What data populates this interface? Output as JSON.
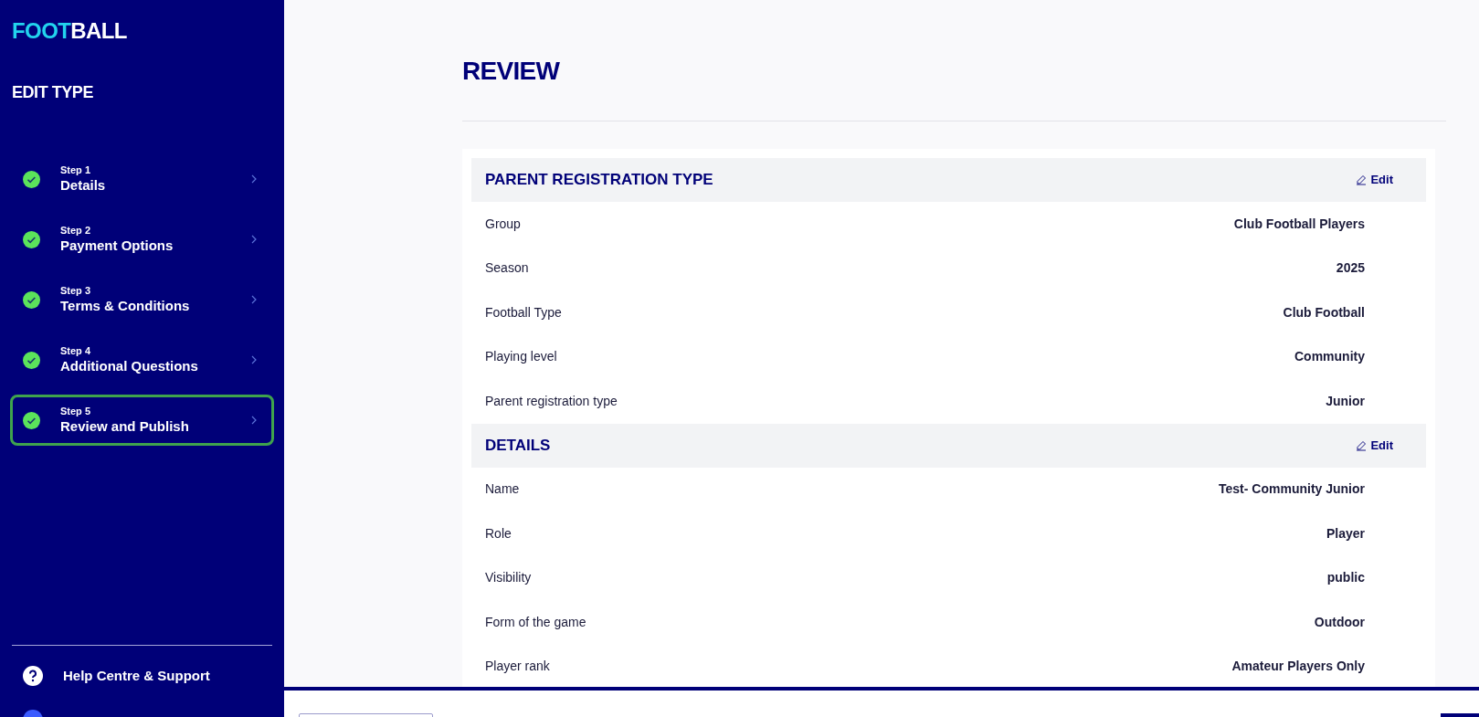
{
  "brand": {
    "part_1": "FOOT",
    "part_2": "BALL"
  },
  "sidebar": {
    "title": "EDIT TYPE",
    "steps": [
      {
        "step": "Step 1",
        "label": "Details",
        "completed": true,
        "selected": false
      },
      {
        "step": "Step 2",
        "label": "Payment Options",
        "completed": true,
        "selected": false
      },
      {
        "step": "Step 3",
        "label": "Terms & Conditions",
        "completed": true,
        "selected": false
      },
      {
        "step": "Step 4",
        "label": "Additional Questions",
        "completed": true,
        "selected": false
      },
      {
        "step": "Step 5",
        "label": "Review and Publish",
        "completed": true,
        "selected": true
      }
    ],
    "help_link": "Help Centre & Support"
  },
  "page_title": "REVIEW",
  "sections": [
    {
      "title": "PARENT REGISTRATION TYPE",
      "edit": "Edit",
      "rows": [
        {
          "label": "Group",
          "value": "Club Football Players"
        },
        {
          "label": "Season",
          "value": "2025"
        },
        {
          "label": "Football Type",
          "value": "Club Football"
        },
        {
          "label": "Playing level",
          "value": "Community"
        },
        {
          "label": "Parent registration type",
          "value": "Junior"
        }
      ]
    },
    {
      "title": "DETAILS",
      "edit": "Edit",
      "rows": [
        {
          "label": "Name",
          "value": "Test- Community Junior"
        },
        {
          "label": "Role",
          "value": "Player"
        },
        {
          "label": "Visibility",
          "value": "public"
        },
        {
          "label": "Form of the game",
          "value": "Outdoor"
        },
        {
          "label": "Player rank",
          "value": "Amateur Players Only"
        }
      ]
    }
  ]
}
